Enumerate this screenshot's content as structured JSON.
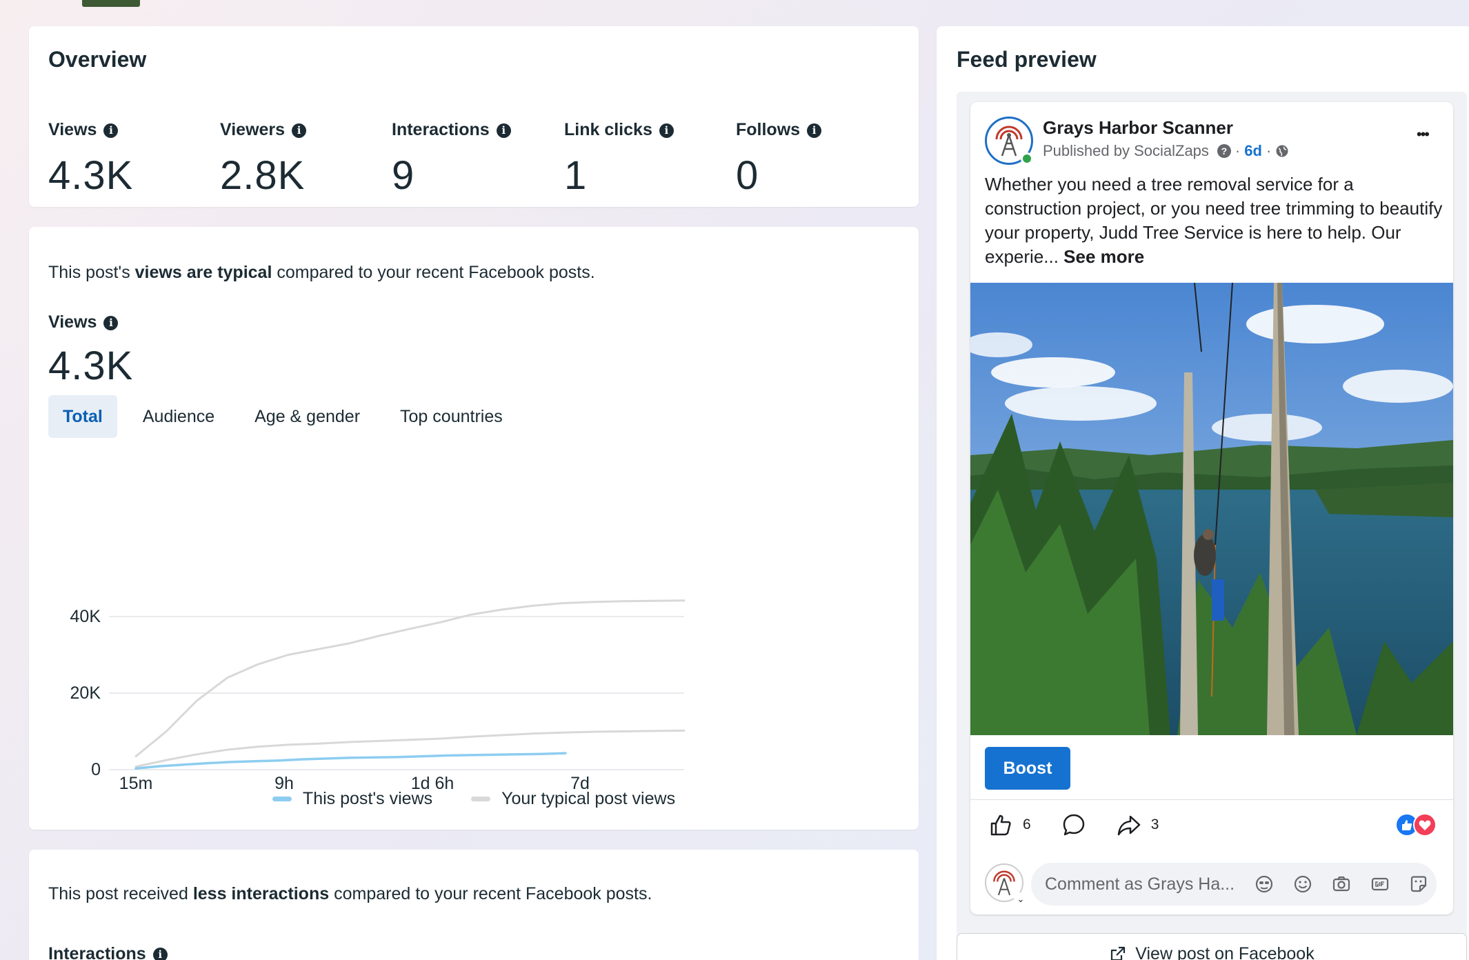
{
  "overview": {
    "title": "Overview",
    "metrics": [
      {
        "label": "Views",
        "value": "4.3K"
      },
      {
        "label": "Viewers",
        "value": "2.8K"
      },
      {
        "label": "Interactions",
        "value": "9"
      },
      {
        "label": "Link clicks",
        "value": "1"
      },
      {
        "label": "Follows",
        "value": "0"
      }
    ]
  },
  "views_card": {
    "sentence_pre": "This post's ",
    "sentence_bold": "views are typical",
    "sentence_post": " compared to your recent Facebook posts.",
    "label": "Views",
    "value": "4.3K",
    "tabs": [
      "Total",
      "Audience",
      "Age & gender",
      "Top countries"
    ],
    "active_tab": "Total"
  },
  "chart_data": {
    "type": "line",
    "x_ticks": [
      "15m",
      "9h",
      "1d 6h",
      "7d"
    ],
    "y_ticks": [
      "0",
      "20K",
      "40K"
    ],
    "ylim": [
      0,
      45000
    ],
    "x_positions": [
      0,
      1,
      2,
      3,
      4,
      5,
      6,
      7,
      8,
      9,
      10,
      11,
      12,
      13,
      14,
      15,
      16,
      17,
      18
    ],
    "series": [
      {
        "name": "This post's views",
        "color": "#8dcdf0",
        "values": [
          300,
          900,
          1300,
          1700,
          2000,
          2200,
          2400,
          2700,
          2900,
          3100,
          3200,
          3300,
          3500,
          3700,
          3800,
          3900,
          4000,
          4100,
          4300
        ]
      },
      {
        "name": "Your typical post views",
        "color": "#d8d8d8",
        "values": [
          3500,
          10000,
          18000,
          24000,
          27500,
          30000,
          31500,
          33000,
          35000,
          36800,
          38500,
          40500,
          41800,
          42800,
          43500,
          43800,
          44000,
          44100,
          44200
        ]
      },
      {
        "name": "",
        "color": "#d8d8d8",
        "values": [
          800,
          2500,
          4000,
          5200,
          6000,
          6500,
          6800,
          7200,
          7500,
          7800,
          8100,
          8600,
          9000,
          9400,
          9700,
          9900,
          10000,
          10100,
          10200
        ]
      }
    ]
  },
  "interactions_card": {
    "sentence_pre": "This post received ",
    "sentence_bold": "less interactions",
    "sentence_post": " compared to your recent Facebook posts.",
    "label": "Interactions"
  },
  "feed_preview": {
    "title": "Feed preview",
    "page_name": "Grays Harbor Scanner",
    "published_by": "Published by SocialZaps",
    "age": "6d",
    "dot": "·",
    "more": "•••",
    "text": "Whether you need a tree removal service for a construction project, or you need tree trimming to beautify your property, Judd Tree Service is here to help. Our experie... ",
    "see_more": "See more",
    "boost_label": "Boost",
    "likes": "6",
    "shares": "3",
    "comment_placeholder": "Comment as Grays Ha...",
    "view_post_label": "View post on Facebook"
  }
}
